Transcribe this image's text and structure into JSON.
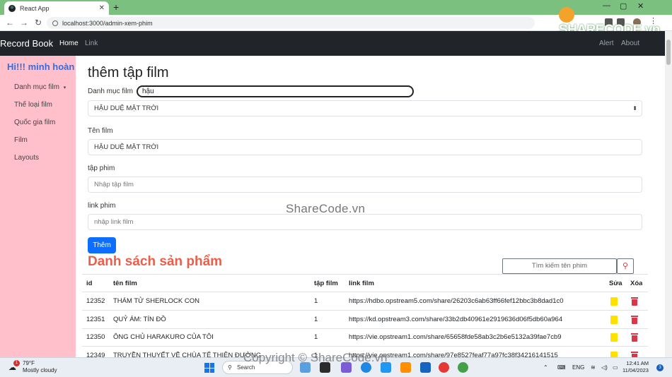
{
  "browser": {
    "tab_title": "React App",
    "url": "localhost:3000/admin-xem-phim",
    "logo_text": "SHARECODE.vn"
  },
  "navbar": {
    "brand": "Record Book",
    "links": [
      "Home",
      "Link"
    ],
    "right_links": [
      "Alert",
      "About"
    ]
  },
  "sidebar": {
    "greeting": "Hi!!! minh hoàn",
    "items": [
      {
        "label": "Danh mục film",
        "dropdown": "▾"
      },
      {
        "label": "Thế loại film"
      },
      {
        "label": "Quốc gia film"
      },
      {
        "label": "Film"
      },
      {
        "label": "Layouts"
      }
    ]
  },
  "form": {
    "title": "thêm tập film",
    "category_label": "Danh mục film",
    "category_input_value": "hậu",
    "category_select_value": "HẬU DUỆ MẶT TRỜI",
    "film_label": "Tên film",
    "film_value": "HẬU DUỆ MẶT TRỜI",
    "episode_label": "tập phim",
    "episode_placeholder": "Nhập tập film",
    "link_label": "link phim",
    "link_placeholder": "nhập link film",
    "submit_label": "Thêm",
    "watermark": "ShareCode.vn"
  },
  "list": {
    "title": "Danh sách sản phẩm",
    "search_placeholder": "Tìm kiếm tên phim",
    "columns": [
      "id",
      "tên film",
      "tập film",
      "link film",
      "Sửa",
      "Xóa"
    ],
    "rows": [
      {
        "id": "12352",
        "name": "THÁM TỬ SHERLOCK CON",
        "episode": "1",
        "link": "https://hdbo.opstream5.com/share/26203c6ab63ff66fef12bbc3b8dad1c0"
      },
      {
        "id": "12351",
        "name": "QUỶ ÁM: TÍN ĐỒ",
        "episode": "1",
        "link": "https://kd.opstream3.com/share/33b2db40961e2919636d06f5db60a964"
      },
      {
        "id": "12350",
        "name": "ÔNG CHỦ HARAKURO CỦA TÔI",
        "episode": "1",
        "link": "https://vie.opstream1.com/share/65658fde58ab3c2b6e5132a39fae7cb9"
      },
      {
        "id": "12349",
        "name": "TRUYỀN THUYẾT VỀ CHÚA TỂ THIÊN ĐƯỜNG",
        "episode": "1",
        "link": "https://vie.opstream1.com/share/97e8527feaf77a97fc38f34216141515"
      }
    ]
  },
  "taskbar": {
    "weather_temp": "79°F",
    "weather_desc": "Mostly cloudy",
    "weather_badge": "1",
    "search_label": "Search",
    "lang": "ENG",
    "time": "12:41 AM",
    "date": "11/04/2023",
    "notif_count": "3",
    "copyright": "Copyright © ShareCode.vn"
  }
}
